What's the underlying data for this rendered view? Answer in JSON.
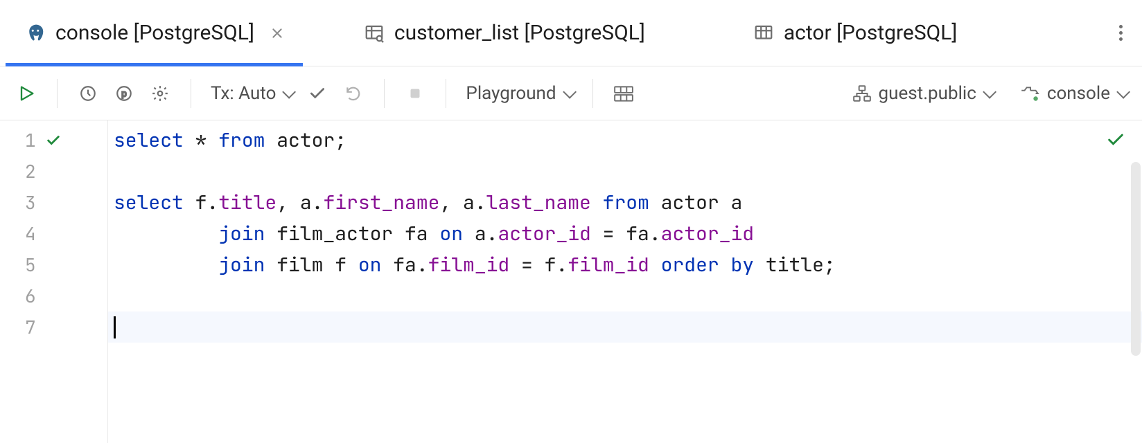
{
  "tabs": [
    {
      "label": "console [PostgreSQL]",
      "icon": "postgres-icon",
      "active": true,
      "closable": true
    },
    {
      "label": "customer_list [PostgreSQL]",
      "icon": "table-search-icon",
      "active": false,
      "closable": false
    },
    {
      "label": "actor [PostgreSQL]",
      "icon": "table-icon",
      "active": false,
      "closable": false
    }
  ],
  "toolbar": {
    "tx_label": "Tx: Auto",
    "playground_label": "Playground",
    "schema_label": "guest.public",
    "console_label": "console"
  },
  "editor": {
    "lines": [
      {
        "num": "1",
        "ok": true,
        "tokens": [
          {
            "t": "select",
            "c": "kw"
          },
          {
            "t": " * ",
            "c": "txt"
          },
          {
            "t": "from",
            "c": "kw"
          },
          {
            "t": " actor;",
            "c": "txt"
          }
        ]
      },
      {
        "num": "2",
        "tokens": []
      },
      {
        "num": "3",
        "tokens": [
          {
            "t": "select",
            "c": "kw"
          },
          {
            "t": " f.",
            "c": "txt"
          },
          {
            "t": "title",
            "c": "col"
          },
          {
            "t": ", a.",
            "c": "txt"
          },
          {
            "t": "first_name",
            "c": "col"
          },
          {
            "t": ", a.",
            "c": "txt"
          },
          {
            "t": "last_name",
            "c": "col"
          },
          {
            "t": " ",
            "c": "txt"
          },
          {
            "t": "from",
            "c": "kw"
          },
          {
            "t": " actor a",
            "c": "txt"
          }
        ]
      },
      {
        "num": "4",
        "tokens": [
          {
            "t": "         ",
            "c": "txt"
          },
          {
            "t": "join",
            "c": "kw"
          },
          {
            "t": " film_actor fa ",
            "c": "txt"
          },
          {
            "t": "on",
            "c": "kw"
          },
          {
            "t": " a.",
            "c": "txt"
          },
          {
            "t": "actor_id",
            "c": "col"
          },
          {
            "t": " = fa.",
            "c": "txt"
          },
          {
            "t": "actor_id",
            "c": "col"
          }
        ]
      },
      {
        "num": "5",
        "tokens": [
          {
            "t": "         ",
            "c": "txt"
          },
          {
            "t": "join",
            "c": "kw"
          },
          {
            "t": " film f ",
            "c": "txt"
          },
          {
            "t": "on",
            "c": "kw"
          },
          {
            "t": " fa.",
            "c": "txt"
          },
          {
            "t": "film_id",
            "c": "col"
          },
          {
            "t": " = f.",
            "c": "txt"
          },
          {
            "t": "film_id",
            "c": "col"
          },
          {
            "t": " ",
            "c": "txt"
          },
          {
            "t": "order by",
            "c": "kw"
          },
          {
            "t": " title;",
            "c": "txt"
          }
        ]
      },
      {
        "num": "6",
        "tokens": []
      },
      {
        "num": "7",
        "current": true,
        "caret": true,
        "tokens": []
      }
    ]
  }
}
